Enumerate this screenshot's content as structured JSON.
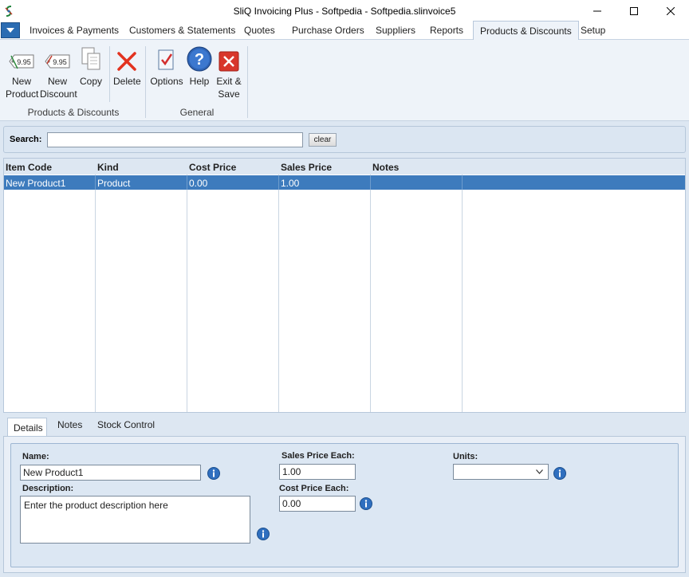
{
  "window": {
    "title": "SliQ Invoicing Plus - Softpedia - Softpedia.slinvoice5"
  },
  "ribbon_tabs": [
    {
      "label": "Invoices & Payments"
    },
    {
      "label": "Customers & Statements"
    },
    {
      "label": "Quotes"
    },
    {
      "label": "Purchase Orders"
    },
    {
      "label": "Suppliers"
    },
    {
      "label": "Reports"
    },
    {
      "label": "Products & Discounts"
    },
    {
      "label": "Setup"
    }
  ],
  "ribbon": {
    "buttons": {
      "new_product": "New\nProduct",
      "new_discount": "New\nDiscount",
      "copy": "Copy",
      "delete": "Delete",
      "options": "Options",
      "help": "Help",
      "exit_save": "Exit &\nSave"
    },
    "groups": {
      "products": "Products & Discounts",
      "general": "General"
    },
    "price_tag_text": "9.95"
  },
  "search": {
    "label": "Search:",
    "value": "",
    "clear_label": "clear"
  },
  "grid": {
    "columns": [
      "Item Code",
      "Kind",
      "Cost Price",
      "Sales Price",
      "Notes"
    ],
    "rows": [
      {
        "item_code": "New Product1",
        "kind": "Product",
        "cost_price": "0.00",
        "sales_price": "1.00",
        "notes": ""
      }
    ]
  },
  "detail_tabs": [
    {
      "label": "Details"
    },
    {
      "label": "Notes"
    },
    {
      "label": "Stock Control"
    }
  ],
  "details": {
    "name_label": "Name:",
    "name_value": "New Product1",
    "description_label": "Description:",
    "description_value": "Enter the product description here",
    "sales_price_label": "Sales Price Each:",
    "sales_price_value": "1.00",
    "cost_price_label": "Cost Price Each:",
    "cost_price_value": "0.00",
    "units_label": "Units:",
    "units_value": ""
  },
  "colors": {
    "selection": "#3d7bbd",
    "panel_bg": "#dce7f3",
    "accent": "#2b6cb2"
  }
}
